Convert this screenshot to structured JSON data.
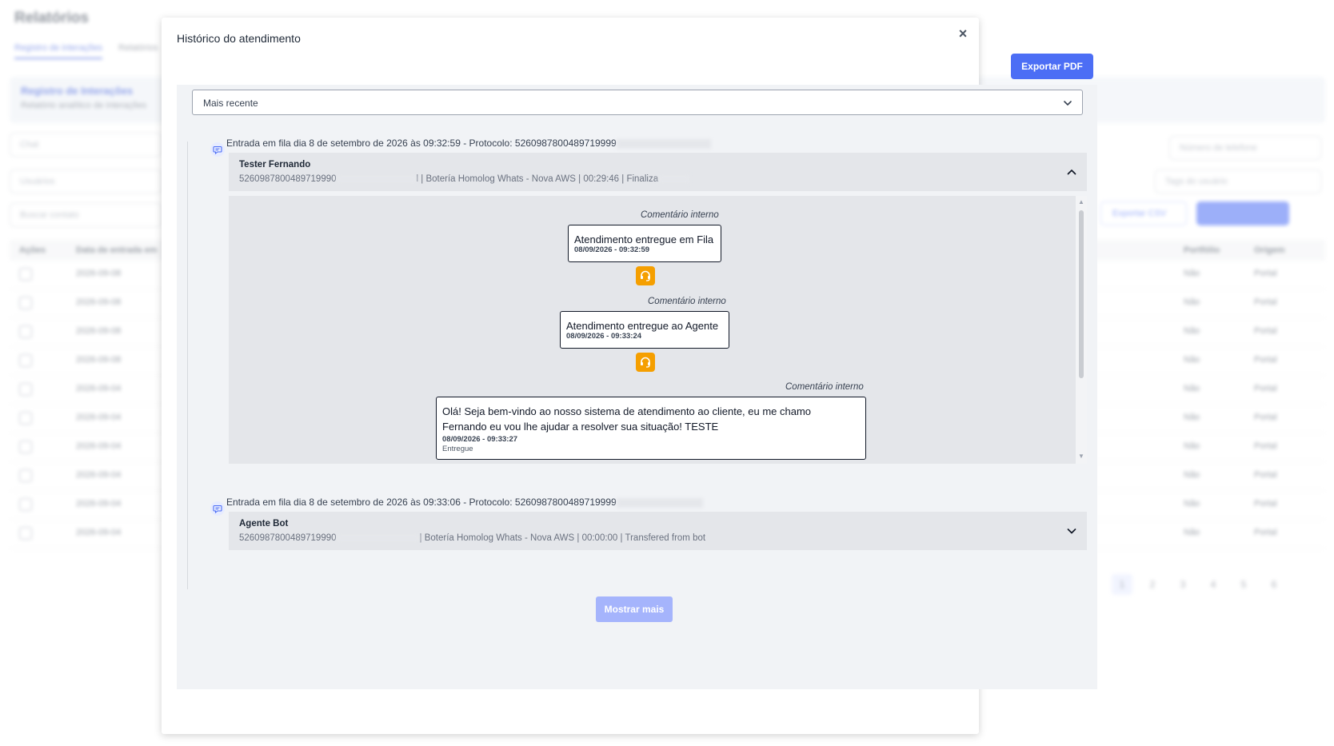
{
  "background": {
    "page_title": "Relatórios",
    "tabs": [
      {
        "label": "Registro de interações"
      },
      {
        "label": "Relatórios"
      }
    ],
    "card_title": "Registro de Interações",
    "card_subtitle": "Relatório analítico de interações",
    "channel_value": "Chat",
    "user_placeholder": "Usuários",
    "contact_placeholder": "Buscar contato",
    "phone_placeholder": "Número de telefone",
    "user_tag_placeholder": "Tags do usuário",
    "export_csv_label": "Exportar CSV",
    "table_headers": [
      "Ações",
      "Data de entrada em",
      "Portfólio",
      "Origem"
    ],
    "rows": [
      {
        "date": "2026-09-08",
        "portfolio": "Não",
        "origin": "Portal"
      },
      {
        "date": "2026-09-08",
        "portfolio": "Não",
        "origin": "Portal"
      },
      {
        "date": "2026-09-08",
        "portfolio": "Não",
        "origin": "Portal"
      },
      {
        "date": "2026-09-08",
        "portfolio": "Não",
        "origin": "Portal"
      },
      {
        "date": "2026-09-04",
        "portfolio": "Não",
        "origin": "Portal"
      },
      {
        "date": "2026-09-04",
        "portfolio": "Não",
        "origin": "Portal"
      },
      {
        "date": "2026-09-04",
        "portfolio": "Não",
        "origin": "Portal"
      },
      {
        "date": "2026-09-04",
        "portfolio": "Não",
        "origin": "Portal"
      },
      {
        "date": "2026-09-04",
        "portfolio": "Não",
        "origin": "Portal"
      },
      {
        "date": "2026-09-04",
        "portfolio": "Não",
        "origin": "Portal"
      }
    ],
    "pages": [
      "1",
      "2",
      "3",
      "4",
      "5",
      "6"
    ]
  },
  "modal": {
    "title": "Histórico do atendimento",
    "close_glyph": "×",
    "export_pdf_label": "Exportar PDF",
    "sort_value": "Mais recente",
    "show_more_label": "Mostrar mais",
    "entries": [
      {
        "heading": "Entrada em fila dia 8 de setembro de 2026 às 09:32:59 - Protocolo: 5260987800489719999",
        "name": "Tester Fernando",
        "meta_prefix": "5260987800489719990",
        "meta_suffix": "l | Botería Homolog Whats - Nova AWS | 00:29:46 | Finaliza",
        "expanded": true
      },
      {
        "heading": "Entrada em fila dia 8 de setembro de 2026 às 09:33:06 - Protocolo: 5260987800489719999",
        "name": "Agente Bot",
        "meta_prefix": "5260987800489719990",
        "meta_suffix": "| Botería Homolog Whats - Nova AWS | 00:00:00 | Transfered from bot",
        "expanded": false
      }
    ],
    "messages": [
      {
        "label": "Comentário interno",
        "text": "Atendimento entregue em Fila",
        "time": "08/09/2026 - 09:32:59"
      },
      {
        "label": "Comentário interno",
        "text": "Atendimento entregue ao Agente",
        "time": "08/09/2026 - 09:33:24"
      },
      {
        "label": "Comentário interno",
        "text_line1": "Olá! Seja bem-vindo ao nosso sistema de atendimento ao cliente, eu me chamo",
        "text_line2": "Fernando eu vou lhe ajudar a resolver sua situação! TESTE",
        "time": "08/09/2026 - 09:33:27",
        "status": "Entregue"
      }
    ],
    "colors": {
      "primary": "#4c6ef5",
      "agent_icon": "#f59f00",
      "show_more": "#a5b4fc"
    }
  }
}
